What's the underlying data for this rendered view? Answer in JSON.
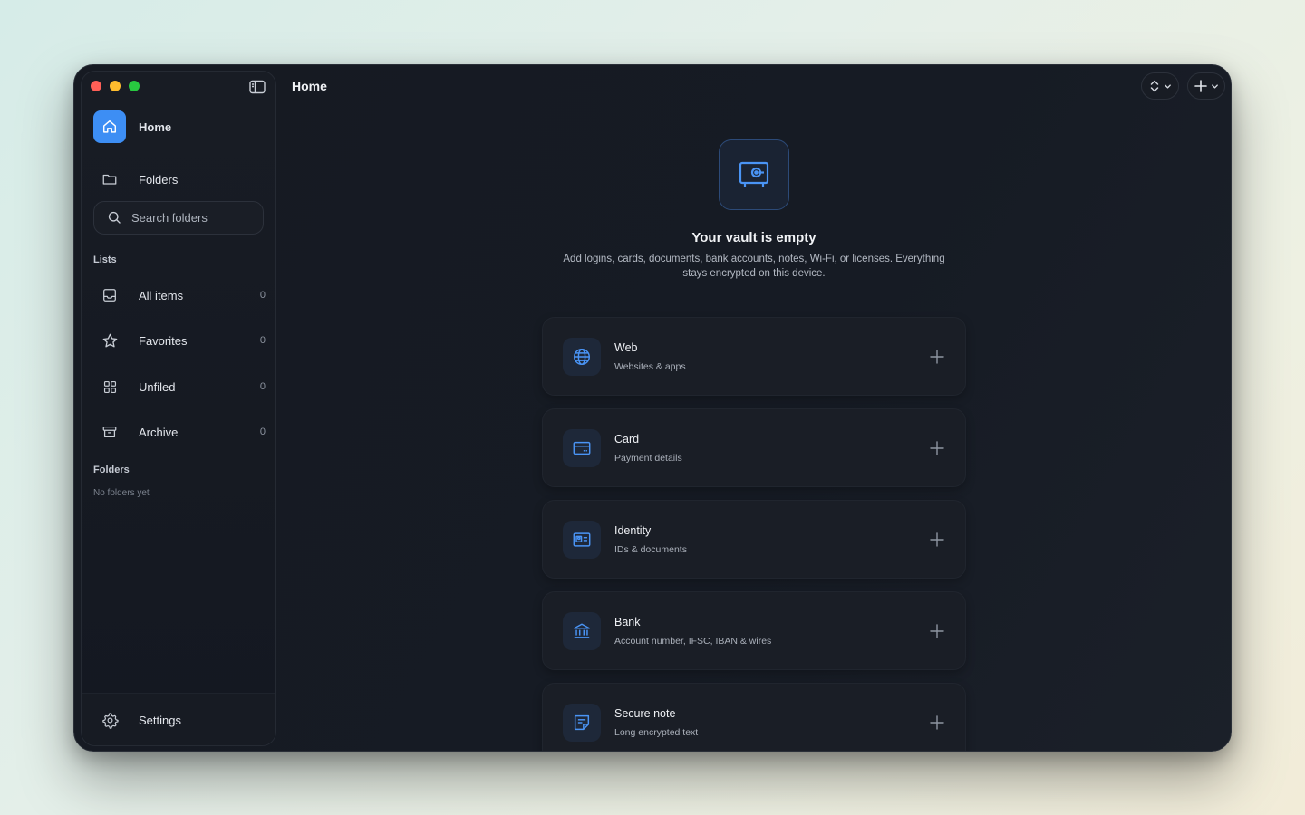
{
  "sidebar": {
    "nav": {
      "home": "Home",
      "folders": "Folders"
    },
    "search_placeholder": "Search folders",
    "lists_title": "Lists",
    "lists": [
      {
        "label": "All items",
        "count": "0",
        "icon": "inbox-icon"
      },
      {
        "label": "Favorites",
        "count": "0",
        "icon": "star-icon"
      },
      {
        "label": "Unfiled",
        "count": "0",
        "icon": "grid-icon"
      },
      {
        "label": "Archive",
        "count": "0",
        "icon": "archive-icon"
      }
    ],
    "folders_title": "Folders",
    "folders_empty": "No folders yet",
    "settings": "Settings"
  },
  "header": {
    "title": "Home"
  },
  "empty_state": {
    "title": "Your vault is empty",
    "description": "Add logins, cards, documents, bank accounts, notes, Wi-Fi, or licenses. Everything stays encrypted on this device."
  },
  "categories": [
    {
      "title": "Web",
      "subtitle": "Websites & apps",
      "icon": "globe-icon"
    },
    {
      "title": "Card",
      "subtitle": "Payment details",
      "icon": "credit-card-icon"
    },
    {
      "title": "Identity",
      "subtitle": "IDs & documents",
      "icon": "id-card-icon"
    },
    {
      "title": "Bank",
      "subtitle": "Account number, IFSC, IBAN & wires",
      "icon": "bank-icon"
    },
    {
      "title": "Secure note",
      "subtitle": "Long encrypted text",
      "icon": "note-icon"
    }
  ],
  "colors": {
    "accent": "#3d8ef4",
    "background": "#161a22"
  }
}
